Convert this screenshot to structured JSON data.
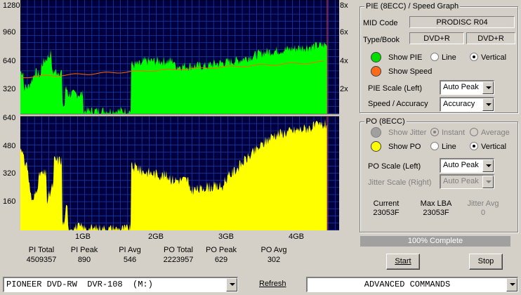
{
  "graphs": {
    "pie_y_ticks": [
      "1280",
      "960",
      "640",
      "320"
    ],
    "speed_y_ticks": [
      "8x",
      "6x",
      "4x",
      "2x"
    ],
    "po_y_ticks": [
      "640",
      "480",
      "320",
      "160"
    ],
    "x_ticks": [
      "1GB",
      "2GB",
      "3GB",
      "4GB"
    ]
  },
  "stats": {
    "headers": [
      "PI Total",
      "PI Peak",
      "PI Avg",
      "PO Total",
      "PO Peak",
      "PO Avg"
    ],
    "values": [
      "4509357",
      "890",
      "546",
      "2223957",
      "629",
      "302"
    ]
  },
  "pie_panel": {
    "title": "PIE (8ECC) / Speed Graph",
    "mid_code_label": "MID Code",
    "mid_code_value": "PRODISC R04",
    "type_book_label": "Type/Book",
    "type_value": "DVD+R",
    "book_value": "DVD+R",
    "show_pie_label": "Show PIE",
    "line_label": "Line",
    "vertical_label": "Vertical",
    "show_speed_label": "Show Speed",
    "pie_scale_label": "PIE Scale (Left)",
    "pie_scale_value": "Auto Peak",
    "speed_accuracy_label": "Speed / Accuracy",
    "speed_accuracy_value": "Accuracy"
  },
  "po_panel": {
    "title": "PO (8ECC)",
    "show_jitter_label": "Show Jitter",
    "instant_label": "Instant",
    "average_label": "Average",
    "show_po_label": "Show PO",
    "line_label": "Line",
    "vertical_label": "Vertical",
    "po_scale_label": "PO Scale (Left)",
    "po_scale_value": "Auto Peak",
    "jitter_scale_label": "Jitter Scale (Right)",
    "jitter_scale_value": "Auto Peak",
    "current_label": "Current",
    "current_value": "23053F",
    "max_lba_label": "Max LBA",
    "max_lba_value": "23053F",
    "jitter_avg_label": "Jitter Avg",
    "jitter_avg_value": "0"
  },
  "progress": {
    "text": "100% Complete",
    "value": 1.0
  },
  "buttons": {
    "start": "Start",
    "stop": "Stop",
    "refresh": "Refresh"
  },
  "drive_select": {
    "value": "PIONEER DVD-RW  DVR-108  (M:)"
  },
  "commands_select": {
    "value": "ADVANCED COMMANDS"
  },
  "colors": {
    "graph_bg": "#000040",
    "grid": "#1a3aa0",
    "pie": "#00ff00",
    "po": "#ffff00",
    "speed": "#ff6600",
    "marker": "#ff3030"
  }
}
